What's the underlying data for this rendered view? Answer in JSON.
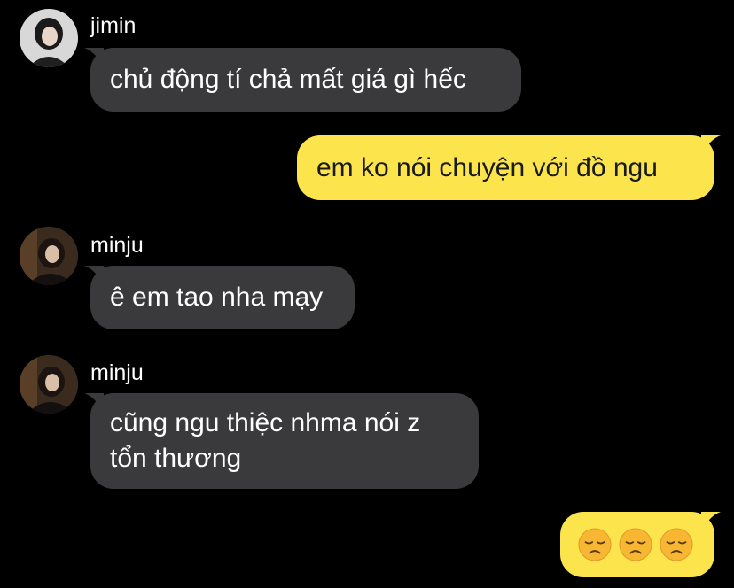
{
  "colors": {
    "background": "#000000",
    "incoming_bubble": "#3a3a3c",
    "outgoing_bubble": "#fbe44c",
    "sender_text": "#ffffff"
  },
  "messages": [
    {
      "sender": "jimin",
      "text": "chủ động tí chả mất giá gì hếc",
      "direction": "incoming"
    },
    {
      "text": "em ko nói chuyện với đồ ngu",
      "direction": "outgoing"
    },
    {
      "sender": "minju",
      "text": "ê em tao nha mạy",
      "direction": "incoming"
    },
    {
      "sender": "minju",
      "text_line1": "cũng ngu thiệc nhma nói z",
      "text_line2": "tổn thương",
      "direction": "incoming"
    },
    {
      "emojis": [
        "disappointed-face-emoji",
        "disappointed-face-emoji",
        "disappointed-face-emoji"
      ],
      "direction": "outgoing"
    }
  ]
}
